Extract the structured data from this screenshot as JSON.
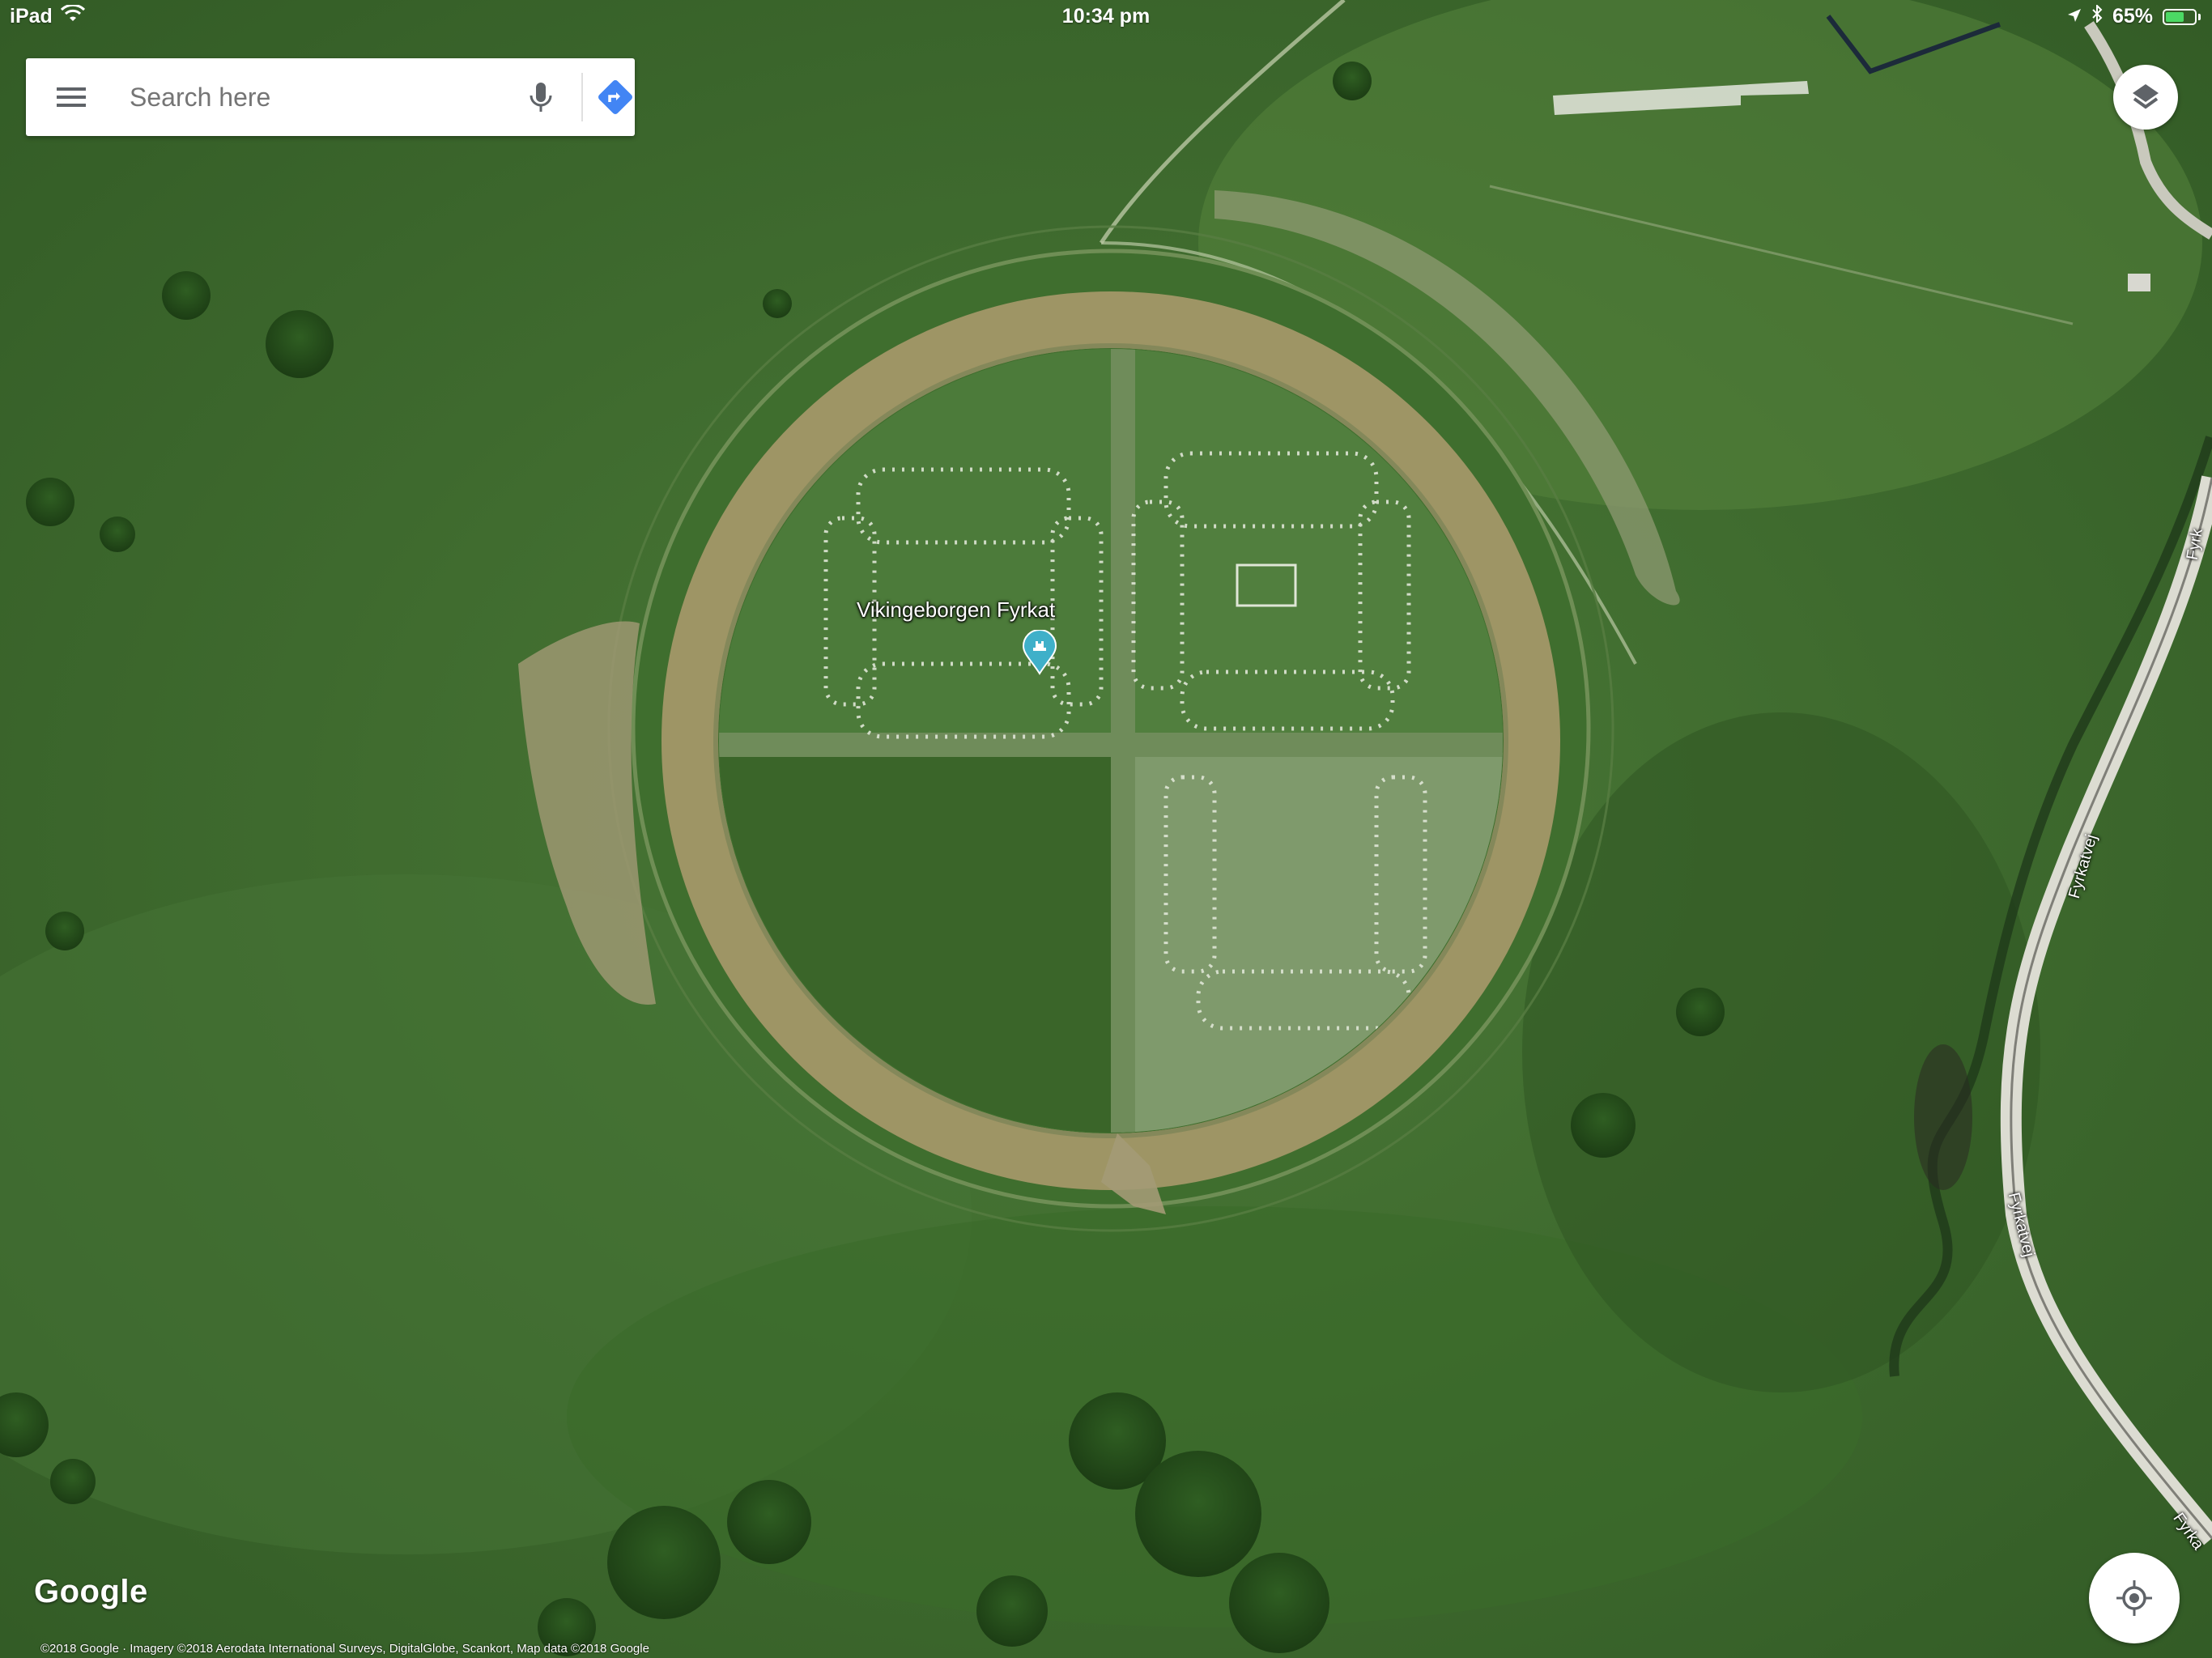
{
  "status_bar": {
    "device": "iPad",
    "time": "10:34 pm",
    "battery": "65%",
    "battery_level": 0.65
  },
  "search": {
    "placeholder": "Search here"
  },
  "map": {
    "place_name": "Vikingeborgen Fyrkat",
    "road_labels": [
      "Fyrkatvej",
      "Fyrkatvej",
      "Fyrka",
      "Fyrk"
    ],
    "logo": "Google",
    "attribution": "©2018 Google · Imagery ©2018 Aerodata International Surveys, DigitalGlobe, Scankort, Map data ©2018 Google"
  },
  "icons": {
    "menu": "menu-icon",
    "mic": "microphone-icon",
    "directions": "directions-icon",
    "layers": "layers-icon",
    "location": "my-location-icon",
    "place": "landmark-pin-icon"
  },
  "colors": {
    "directions_blue": "#4285f4",
    "pin_teal": "#3fb0c9",
    "battery_green": "#4cd964"
  }
}
